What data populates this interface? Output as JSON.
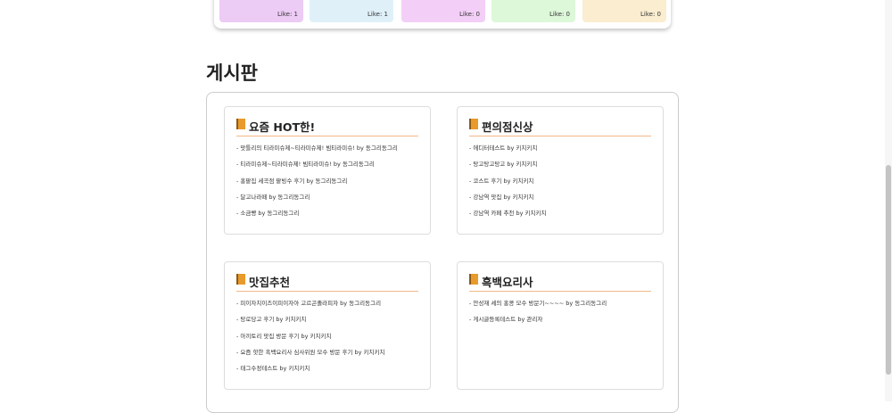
{
  "post_cards": [
    {
      "like": "Like: 1",
      "color": "#eccbf5"
    },
    {
      "like": "Like: 1",
      "color": "#dff0f9"
    },
    {
      "like": "Like: 0",
      "color": "#f3cff7"
    },
    {
      "like": "Like: 0",
      "color": "#ddf7d9"
    },
    {
      "like": "Like: 0",
      "color": "#faedd0"
    }
  ],
  "board": {
    "title": "게시판",
    "sections": [
      {
        "title": "요즘 HOT한!",
        "icon": "book-icon",
        "items": [
          "- 맛틀리의 티라미슈제~티라미슈제! 빔티라미슈! by 동그리동그리",
          "- 티라미슈제~티라미슈제! 빔티라미슈! by 동그리동그리",
          "- 홍팥집 세곡점 팥빙수 후기 by 동그리동그리",
          "- 달고나라떼 by 동그리동그리",
          "- 소금빵 by 동그리동그리"
        ]
      },
      {
        "title": "편의점신상",
        "icon": "book-icon",
        "items": [
          "- 에디터테스트 by 키치키치",
          "- 탕고탕고탕고 by 키치키치",
          "- 코스트 후기 by 키치키치",
          "- 강남역 맛집 by 키치키치",
          "- 강남역 카페 추천 by 키치키치"
        ]
      },
      {
        "title": "맛집추천",
        "icon": "book-icon",
        "items": [
          "- 피이자치이즈이피이자아 고르곤졸라피자 by 동그리동그리",
          "- 탕로당고 후기 by 키치키치",
          "- 아끼토리 맛집 방문 후기 by 키치키치",
          "- 요즘 핫한 흑백요리사 심사위원 모수 방문 후기 by 키치키치",
          "- 태그수정테스트 by 키치키치"
        ]
      },
      {
        "title": "흑백요리사",
        "icon": "book-icon",
        "items": [
          "- 안성재 셰의 홍콩 모수 방문기~~~~ by 동그리동그리",
          "- 게시글등록테스트 by 관리자"
        ]
      }
    ]
  }
}
